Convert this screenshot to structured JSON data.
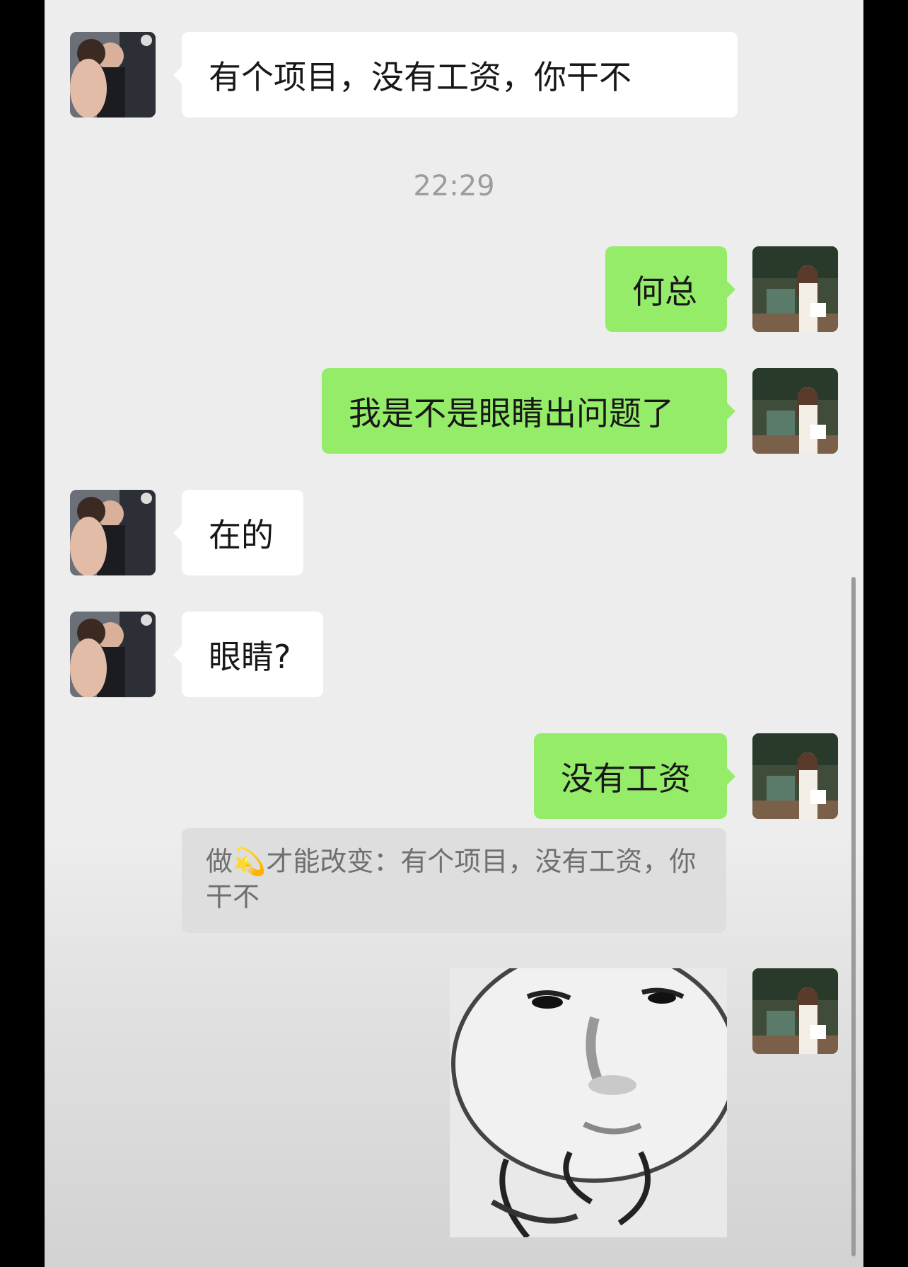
{
  "chat": {
    "timestamp": "22:29",
    "messages": [
      {
        "from": "contact",
        "text": "有个项目，没有工资，你干不"
      },
      {
        "from": "me",
        "text": "何总"
      },
      {
        "from": "me",
        "text": "我是不是眼睛出问题了"
      },
      {
        "from": "contact",
        "text": "在的"
      },
      {
        "from": "contact",
        "text": "眼睛?"
      },
      {
        "from": "me",
        "text": "没有工资"
      }
    ],
    "quote": {
      "prefix": "做",
      "emoji": "💫",
      "body": "才能改变：有个项目，没有工资，你干不"
    }
  },
  "colors": {
    "background": "#ededed",
    "incoming_bubble": "#ffffff",
    "outgoing_bubble": "#95ec69",
    "timestamp_text": "#9c9c9c",
    "quote_background": "#dedede"
  },
  "icons": {
    "contact_avatar": "contact-avatar",
    "my_avatar": "my-avatar",
    "sticker": "face-meme-sticker"
  }
}
